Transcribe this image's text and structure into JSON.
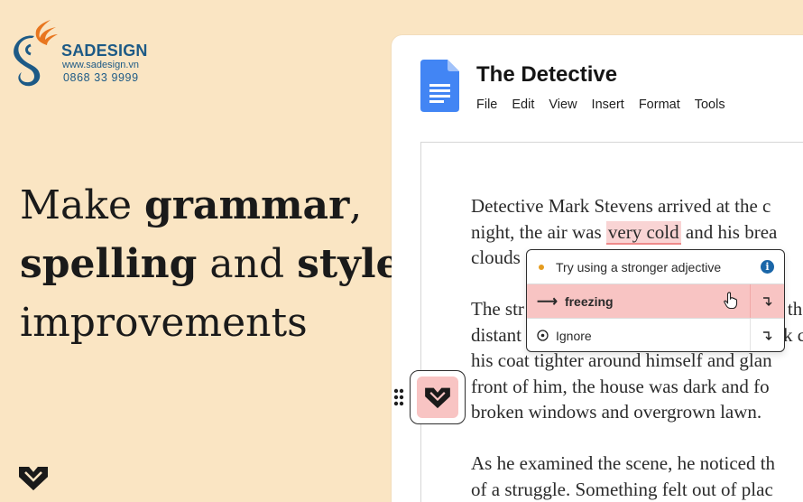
{
  "logo": {
    "name": "SADESIGN",
    "url": "www.sadesign.vn",
    "phone": "0868 33 9999",
    "colors": {
      "flame": "#e8761f",
      "ink": "#1d5a86"
    }
  },
  "headline": {
    "line1": {
      "part1": "Make ",
      "bold1": "grammar",
      "part2": ","
    },
    "line2": {
      "bold1": "spelling",
      "part1": " and ",
      "bold2": "style"
    },
    "line3": {
      "part1": "improvements"
    }
  },
  "brand_icon": "heart-chevron-icon",
  "document": {
    "app_icon": "google-docs-icon",
    "title": "The Detective",
    "menu": [
      "File",
      "Edit",
      "View",
      "Insert",
      "Format",
      "Tools"
    ],
    "paragraph1": {
      "line1": "Detective Mark Stevens arrived at the c",
      "line2_before": "night, the air was ",
      "line2_flag": "very cold",
      "line2_after": " and his brea",
      "line3": "clouds"
    },
    "paragraph2": {
      "line1_start": "The str",
      "line1_end": "th",
      "line2_start": "distant",
      "line2_end": "k c",
      "line3": "his coat tighter around himself and glan",
      "line4": "front of him, the house was dark and fo",
      "line5": "broken windows and overgrown lawn."
    },
    "paragraph3": {
      "line1": "As he examined the scene, he noticed th",
      "line2": "of a struggle. Something felt out of plac"
    }
  },
  "suggestion": {
    "title": "Try using a stronger adjective",
    "replacement": "freezing",
    "ignore_label": "Ignore",
    "colors": {
      "dot": "#e59c1f",
      "info": "#1a66a8",
      "highlight": "#f8c4c3"
    }
  }
}
